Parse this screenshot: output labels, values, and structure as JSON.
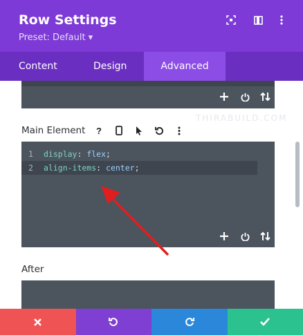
{
  "header": {
    "title": "Row Settings",
    "preset": "Preset: Default ▾",
    "icons": [
      "focus-icon",
      "layout-icon",
      "more-vertical-icon"
    ]
  },
  "tabs": [
    {
      "label": "Content",
      "active": false
    },
    {
      "label": "Design",
      "active": false
    },
    {
      "label": "Advanced",
      "active": true
    }
  ],
  "sections": {
    "main_element": {
      "label": "Main Element",
      "icons": [
        "help-icon",
        "mobile-icon",
        "cursor-icon",
        "undo-icon",
        "more-vertical-icon"
      ],
      "code": [
        {
          "number": "1",
          "property": "display",
          "value": "flex"
        },
        {
          "number": "2",
          "property": "align-items",
          "value": "center"
        }
      ]
    },
    "after": {
      "label": "After"
    }
  },
  "toolbar": {
    "icons": [
      "add-icon",
      "power-icon",
      "sort-icon"
    ]
  },
  "watermark": "THIRABUILD.COM",
  "footer": {
    "buttons": [
      {
        "name": "cancel",
        "color": "#f05353",
        "icon": "close-icon"
      },
      {
        "name": "undo",
        "color": "#7e3fd2",
        "icon": "undo-icon"
      },
      {
        "name": "redo",
        "color": "#2b87da",
        "icon": "redo-icon"
      },
      {
        "name": "save",
        "color": "#2bc28f",
        "icon": "check-icon"
      }
    ]
  },
  "colors": {
    "header": "#7d3ad6",
    "tabs": "#6a2fc0",
    "active_tab": "#8c4ce6",
    "editor": "#4c545e",
    "arrow": "#e01e1e"
  }
}
